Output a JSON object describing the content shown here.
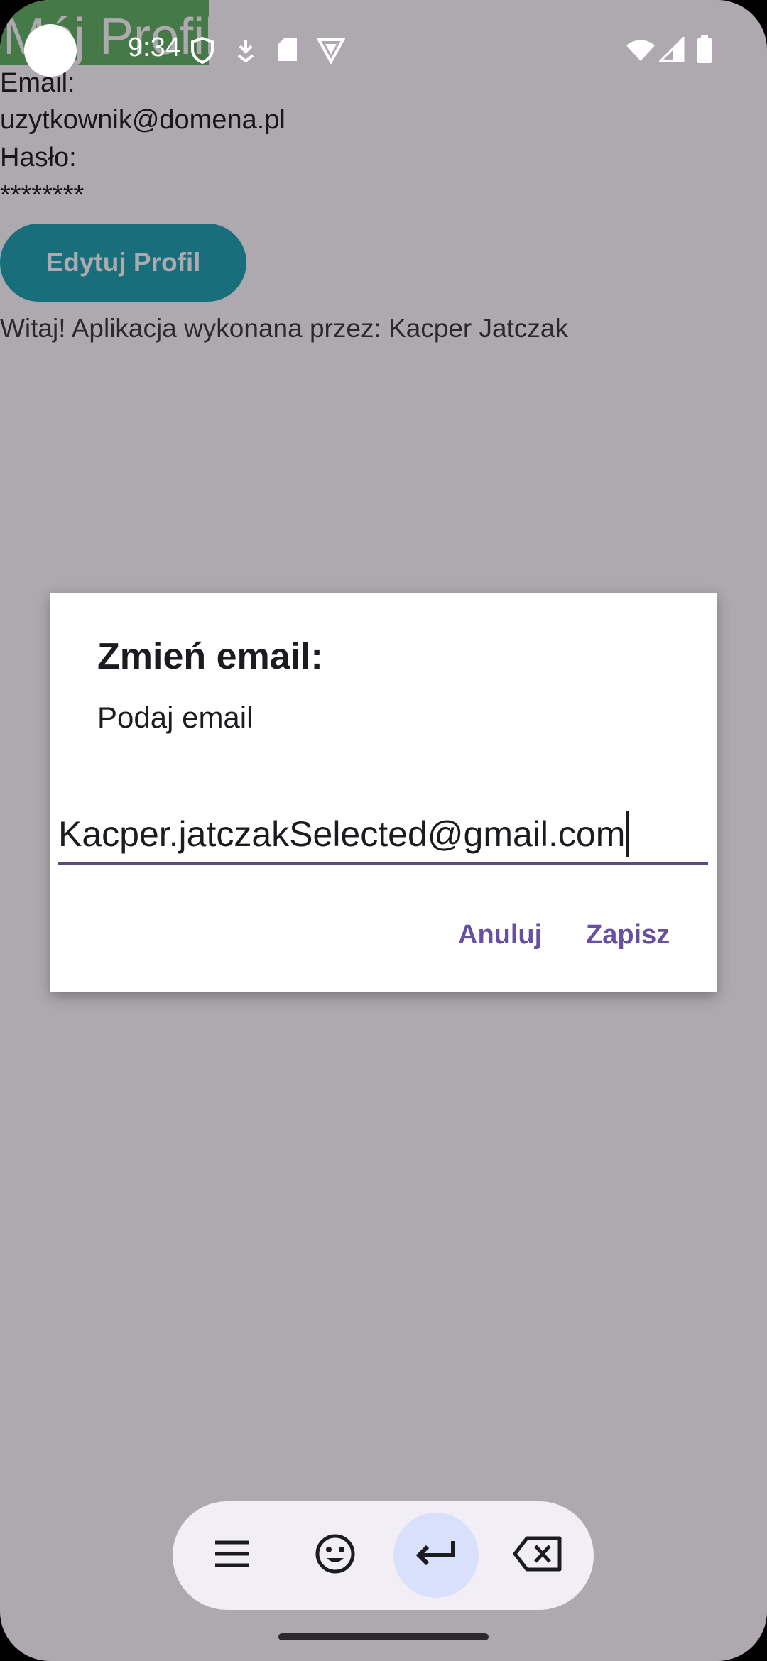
{
  "status_bar": {
    "time": "9:34",
    "icons": [
      "shield-icon",
      "download-icon",
      "sd-card-icon",
      "vpn-icon",
      "wifi-icon",
      "signal-icon",
      "battery-icon"
    ]
  },
  "app": {
    "title": "Mój Profil",
    "email_label": "Email:",
    "email_value": "uzytkownik@domena.pl",
    "password_label": "Hasło:",
    "password_value": "********",
    "edit_button_label": "Edytuj Profil",
    "welcome_text": "Witaj! Aplikacja wykonana przez: Kacper Jatczak"
  },
  "dialog": {
    "title": "Zmień email:",
    "message": "Podaj email",
    "input_value": "Kacper.jatczakSelected@gmail.com",
    "cancel_label": "Anuluj",
    "save_label": "Zapisz"
  },
  "keyboard_toolbar": {
    "keys": [
      "menu-icon",
      "emoji-icon",
      "enter-icon",
      "backspace-icon"
    ],
    "active_key": "enter-icon"
  },
  "colors": {
    "accent": "#6750a4",
    "edit_button": "#009aaa",
    "title_bar": "#4caf50"
  }
}
